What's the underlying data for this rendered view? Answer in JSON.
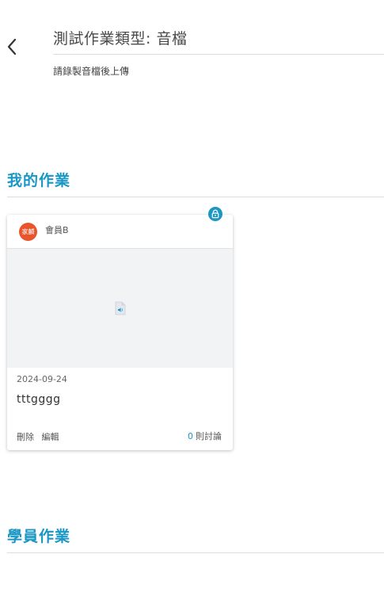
{
  "header": {
    "title": "測試作業類型: 音檔",
    "instructions": "請錄製音檔後上傳"
  },
  "my_section": {
    "title": "我的作業"
  },
  "card": {
    "avatar_text": "家麟",
    "member_name": "會員B",
    "date": "2024-09-24",
    "text": "tttgggg",
    "delete_label": "刪除",
    "edit_label": "編輯",
    "comment_count": "0",
    "comment_label": "則討論"
  },
  "students_section": {
    "title": "學員作業"
  },
  "icons": {
    "back": "chevron-left-icon",
    "lock": "lock-icon",
    "audio": "audio-file-icon"
  },
  "colors": {
    "accent": "#1a97c4",
    "avatar": "#e8542c"
  }
}
